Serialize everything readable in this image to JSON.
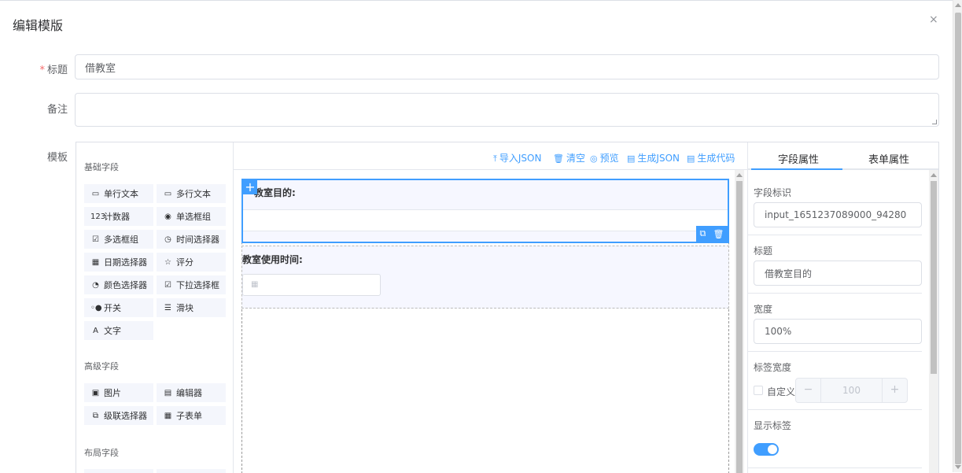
{
  "dialog": {
    "title": "编辑模版",
    "close_glyph": "×"
  },
  "form": {
    "title_label": "标题",
    "title_required_mark": "*",
    "title_value": "借教室",
    "remark_label": "备注",
    "remark_value": "",
    "template_label": "模板"
  },
  "palette": {
    "basic_title": "基础字段",
    "basic_items": [
      {
        "label": "单行文本",
        "icon": "single-line-text-icon",
        "glyph": "▭"
      },
      {
        "label": "多行文本",
        "icon": "multi-line-text-icon",
        "glyph": "▭"
      },
      {
        "label": "计数器",
        "icon": "counter-icon",
        "glyph": "123"
      },
      {
        "label": "单选框组",
        "icon": "radio-icon",
        "glyph": "◉"
      },
      {
        "label": "多选框组",
        "icon": "checkbox-icon",
        "glyph": "☑"
      },
      {
        "label": "时间选择器",
        "icon": "clock-icon",
        "glyph": "◷"
      },
      {
        "label": "日期选择器",
        "icon": "calendar-icon",
        "glyph": "▦"
      },
      {
        "label": "评分",
        "icon": "star-icon",
        "glyph": "☆"
      },
      {
        "label": "颜色选择器",
        "icon": "palette-icon",
        "glyph": "◔"
      },
      {
        "label": "下拉选择框",
        "icon": "select-icon",
        "glyph": "☑"
      },
      {
        "label": "开关",
        "icon": "switch-icon",
        "glyph": "◦●"
      },
      {
        "label": "滑块",
        "icon": "slider-icon",
        "glyph": "☰"
      },
      {
        "label": "文字",
        "icon": "text-icon",
        "glyph": "A"
      }
    ],
    "advanced_title": "高级字段",
    "advanced_items": [
      {
        "label": "图片",
        "icon": "image-icon",
        "glyph": "▣"
      },
      {
        "label": "编辑器",
        "icon": "editor-icon",
        "glyph": "▤"
      },
      {
        "label": "级联选择器",
        "icon": "cascader-icon",
        "glyph": "⧉"
      },
      {
        "label": "子表单",
        "icon": "table-icon",
        "glyph": "▦"
      }
    ],
    "layout_title": "布局字段"
  },
  "toolbar": {
    "import_json": "导入JSON",
    "clear": "清空",
    "preview": "预览",
    "generate_json": "生成JSON",
    "generate_code": "生成代码"
  },
  "canvas": {
    "items": [
      {
        "label": "教室目的:",
        "type": "input",
        "selected": true
      },
      {
        "label": "教室使用时间:",
        "type": "date"
      }
    ]
  },
  "props": {
    "tab_field": "字段属性",
    "tab_form": "表单属性",
    "field_id_label": "字段标识",
    "field_id_value": "input_1651237089000_94280",
    "title_label": "标题",
    "title_value": "借教室目的",
    "width_label": "宽度",
    "width_value": "100%",
    "label_width_label": "标签宽度",
    "custom_label": "自定义",
    "custom_checked": false,
    "label_width_value": "100",
    "stepper_minus": "−",
    "stepper_plus": "+",
    "show_label_label": "显示标签",
    "show_label_on": true
  },
  "colors": {
    "accent": "#409eff",
    "required": "#f56c6c"
  }
}
